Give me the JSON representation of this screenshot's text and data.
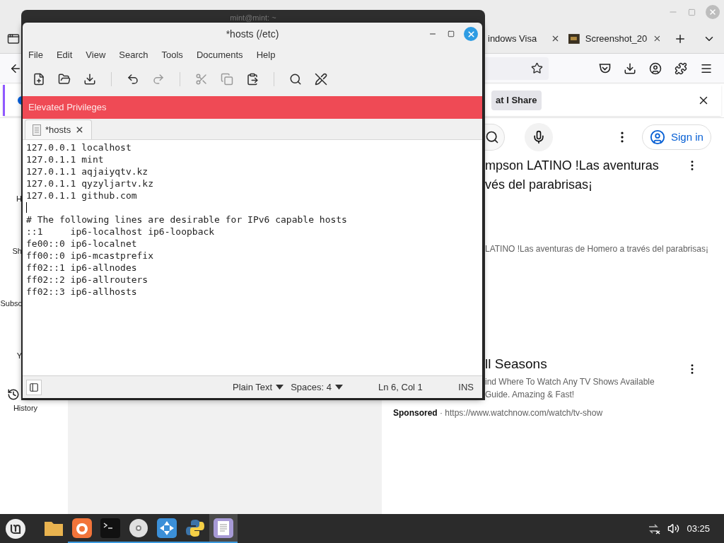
{
  "browser": {
    "tabs": [
      {
        "label": "indows Visa",
        "selected": false
      },
      {
        "label": "Screenshot_20",
        "selected": false
      }
    ],
    "share_button": "at I Share",
    "sign_in": "Sign in",
    "sidebar": [
      {
        "label": "H",
        "kind": "clipped"
      },
      {
        "label": "Sh",
        "kind": "clipped"
      },
      {
        "label": "Subsc",
        "kind": "clipped"
      },
      {
        "label": "Y",
        "kind": "clipped"
      },
      {
        "label": "History",
        "kind": "full"
      }
    ],
    "video": {
      "title_lines": [
        "mpson LATINO !Las aventuras",
        "vés del parabrisas¡"
      ],
      "description": "LATINO !Las aventuras de Homero a través del parabrisas¡"
    },
    "ad": {
      "title": "ll Seasons",
      "description_lines": [
        "ind Where To Watch Any TV Shows Available",
        "Guide. Amazing & Fast!"
      ],
      "sponsor_line": "**Sponsored** · https://www.watchnow.com/watch/tv-show"
    }
  },
  "terminal": {
    "title": "mint@mint: ~"
  },
  "editor": {
    "title": "*hosts (/etc)",
    "menu": [
      "File",
      "Edit",
      "View",
      "Search",
      "Tools",
      "Documents",
      "Help"
    ],
    "banner": "Elevated Privileges",
    "tab": "*hosts",
    "blocks": [
      [
        "127.0.0.1 localhost",
        "127.0.1.1 mint",
        "127.0.1.1 aqjaiyqtv.kz",
        "127.0.1.1 qyzyljartv.kz",
        "127.0.1.1 github.com"
      ],
      [
        "# The following lines are desirable for IPv6 capable hosts",
        "::1     ip6-localhost ip6-loopback",
        "fe00::0 ip6-localnet",
        "ff00::0 ip6-mcastprefix",
        "ff02::1 ip6-allnodes",
        "ff02::2 ip6-allrouters",
        "ff02::3 ip6-allhosts"
      ]
    ],
    "status": {
      "language": "Plain Text",
      "indent": "Spaces: 4",
      "position": "Ln 6, Col 1",
      "mode": "INS"
    }
  },
  "taskbar": {
    "apps": [
      {
        "kind": "folder",
        "running": false,
        "active": false
      },
      {
        "kind": "firefox",
        "running": true,
        "active": false
      },
      {
        "kind": "terminal",
        "running": true,
        "active": false
      },
      {
        "kind": "disc",
        "running": true,
        "active": false
      },
      {
        "kind": "bluegrid",
        "running": true,
        "active": false
      },
      {
        "kind": "python",
        "running": true,
        "active": false
      },
      {
        "kind": "editor",
        "running": true,
        "active": true
      }
    ],
    "clock": "03:25"
  }
}
